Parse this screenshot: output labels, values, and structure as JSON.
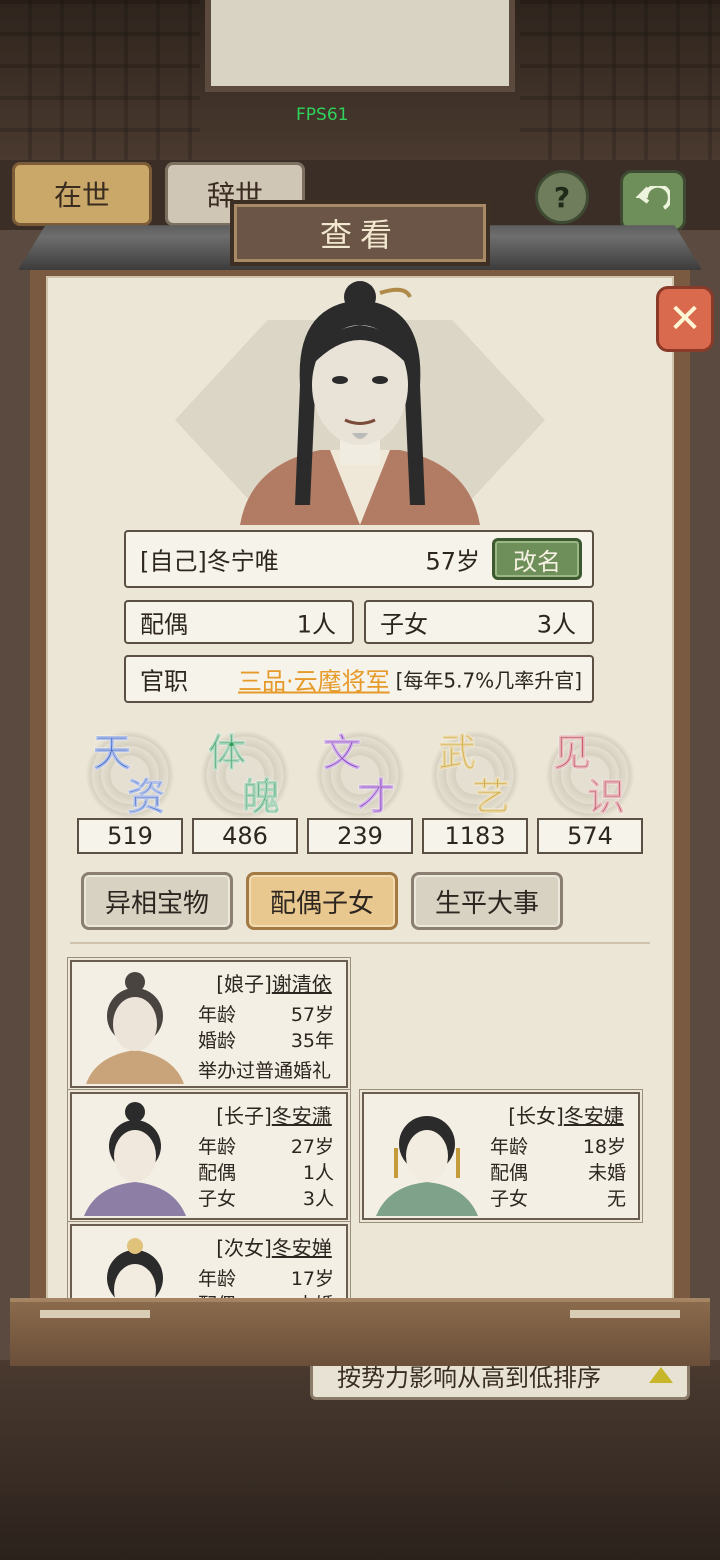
{
  "fps": "FPS61",
  "background": {
    "tabs": [
      "在世",
      "辞世"
    ],
    "help_icon": "?",
    "sort_label": "按势力影响从高到低排序"
  },
  "modal": {
    "title": "查看",
    "close_icon": "close-icon"
  },
  "self": {
    "name": "[自己]冬宁唯",
    "age": "57岁",
    "rename_label": "改名",
    "spouse_label": "配偶",
    "spouse_count": "1人",
    "children_label": "子女",
    "children_count": "3人",
    "office_label": "官职",
    "office_title": "三品·云麾将军",
    "office_note": "[每年5.7%几率升官]"
  },
  "attributes": [
    {
      "chars": [
        "天",
        "资"
      ],
      "value": "519",
      "color": "#3a63c9"
    },
    {
      "chars": [
        "体",
        "魄"
      ],
      "value": "486",
      "color": "#2f9a5a"
    },
    {
      "chars": [
        "文",
        "才"
      ],
      "value": "239",
      "color": "#8a3fc0"
    },
    {
      "chars": [
        "武",
        "艺"
      ],
      "value": "1183",
      "color": "#c99a1f"
    },
    {
      "chars": [
        "见",
        "识"
      ],
      "value": "574",
      "color": "#c04a55"
    }
  ],
  "subtabs": [
    {
      "label": "异相宝物",
      "active": false
    },
    {
      "label": "配偶子女",
      "active": true
    },
    {
      "label": "生平大事",
      "active": false
    }
  ],
  "family": [
    {
      "tag": "[娘子]",
      "name": "谢清依",
      "rows": [
        {
          "k": "年龄",
          "v": "57岁"
        },
        {
          "k": "婚龄",
          "v": "35年"
        }
      ],
      "note": "举办过普通婚礼"
    },
    {
      "tag": "[长子]",
      "name": "冬安潇",
      "rows": [
        {
          "k": "年龄",
          "v": "27岁"
        },
        {
          "k": "配偶",
          "v": "1人"
        },
        {
          "k": "子女",
          "v": "3人"
        }
      ]
    },
    {
      "tag": "[长女]",
      "name": "冬安婕",
      "rows": [
        {
          "k": "年龄",
          "v": "18岁"
        },
        {
          "k": "配偶",
          "v": "未婚"
        },
        {
          "k": "子女",
          "v": "无"
        }
      ]
    },
    {
      "tag": "[次女]",
      "name": "冬安婵",
      "rows": [
        {
          "k": "年龄",
          "v": "17岁"
        },
        {
          "k": "配偶",
          "v": "未婚"
        }
      ]
    }
  ]
}
